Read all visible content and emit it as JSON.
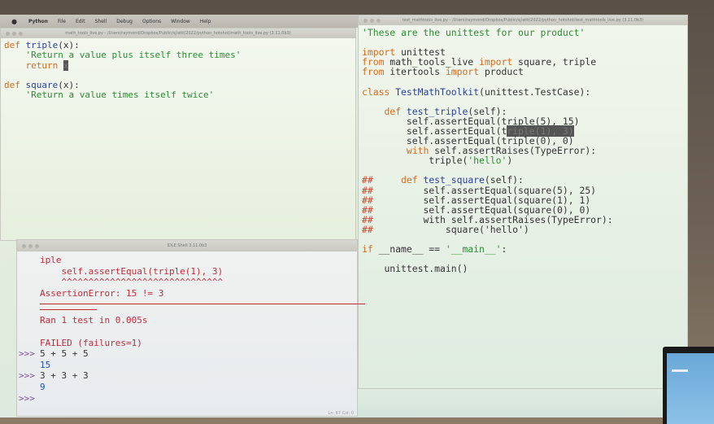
{
  "menubar": {
    "items": [
      "Python",
      "File",
      "Edit",
      "Shell",
      "Debug",
      "Options",
      "Window",
      "Help"
    ]
  },
  "left_editor": {
    "title": "math_tools_live.py - /Users/raymond/Dropbox/Public/sj/attl/2022/python_hotshot/math_tools_live.py (3.11.0b3)",
    "lines": [
      {
        "kw": "def ",
        "fn": "triple",
        "rest": "(x):"
      },
      {
        "indent": "    ",
        "st": "'Return a value plus itself three times'"
      },
      {
        "indent": "    ",
        "kw": "return ",
        "hl": "x"
      },
      {
        "blank": ""
      },
      {
        "kw": "def ",
        "fn": "square",
        "rest": "(x):"
      },
      {
        "indent": "    ",
        "st": "'Return a value times itself twice'"
      }
    ]
  },
  "right_editor": {
    "title": "test_mathtools_live.py - /Users/raymond/Dropbox/Public/sj/attl/2022/python_hotshot/test_mathtools_live.py (3.11.0b3)",
    "lines": [
      {
        "st": "'These are the unittest for our product'"
      },
      {
        "blank": ""
      },
      {
        "kw": "import ",
        "rest": "unittest"
      },
      {
        "kw": "from ",
        "rest": "math_tools_live ",
        "kw2": "import ",
        "rest2": "square, triple"
      },
      {
        "kw": "from ",
        "rest": "itertools ",
        "kw2": "import ",
        "rest2": "product"
      },
      {
        "blank": ""
      },
      {
        "kw": "class ",
        "fn": "TestMathToolkit",
        "rest": "(unittest.TestCase):"
      },
      {
        "blank": ""
      },
      {
        "indent": "    ",
        "kw": "def ",
        "fn": "test_triple",
        "rest": "(self):"
      },
      {
        "indent": "        ",
        "rest": "self.assertEqual(triple(5), 15)"
      },
      {
        "indent": "        ",
        "rest": "self.assertEqual(t",
        "hl": "riple(1), 3)"
      },
      {
        "indent": "        ",
        "rest": "self.assertEqual(triple(0), 0)"
      },
      {
        "indent": "        ",
        "kw": "with ",
        "rest": "self.assertRaises(TypeError):"
      },
      {
        "indent": "            ",
        "rest": "triple(",
        "st": "'hello'",
        "rest2": ")"
      },
      {
        "blank": ""
      },
      {
        "cm": "##",
        "indent": "    ",
        "kw": "def ",
        "fn": "test_square",
        "rest": "(self):"
      },
      {
        "cm": "##",
        "indent": "        ",
        "rest": "self.assertEqual(square(5), 25)"
      },
      {
        "cm": "##",
        "indent": "        ",
        "rest": "self.assertEqual(square(1), 1)"
      },
      {
        "cm": "##",
        "indent": "        ",
        "rest": "self.assertEqual(square(0), 0)"
      },
      {
        "cm": "##",
        "indent": "        ",
        "rest": "with self.assertRaises(TypeError):"
      },
      {
        "cm": "##",
        "indent": "            ",
        "rest": "square('hello')"
      },
      {
        "blank": ""
      },
      {
        "kw": "if ",
        "rest": "__name__ == ",
        "st": "'__main__'",
        "rest2": ":"
      },
      {
        "blank": ""
      },
      {
        "indent": "    ",
        "rest": "unittest.main()"
      }
    ]
  },
  "shell": {
    "title": "IDLE Shell 3.11.0b3",
    "status": "Ln: 67  Col: 0",
    "lines": [
      {
        "cls": "err",
        "text": "iple"
      },
      {
        "cls": "err",
        "text": "    self.assertEqual(triple(1), 3)"
      },
      {
        "cls": "err",
        "text": "    ^^^^^^^^^^^^^^^^^^^^^^^^^^^^^^"
      },
      {
        "cls": "err",
        "text": "AssertionError: 15 != 3"
      },
      {
        "cls": "sep"
      },
      {
        "cls": "sep short"
      },
      {
        "cls": "err",
        "text": "Ran 1 test in 0.005s"
      },
      {
        "cls": "err",
        "text": ""
      },
      {
        "cls": "err",
        "text": "FAILED (failures=1)"
      },
      {
        "cls": "in",
        "prompt": ">>>",
        "text": "5 + 5 + 5"
      },
      {
        "cls": "out",
        "text": "15"
      },
      {
        "cls": "in",
        "prompt": ">>>",
        "text": "3 + 3 + 3"
      },
      {
        "cls": "out",
        "text": "9"
      },
      {
        "cls": "in",
        "prompt": ">>>",
        "text": ""
      }
    ]
  },
  "colors": {
    "keyword": "#d06d22",
    "function_name": "#2b3f9a",
    "string": "#2c8a35",
    "error": "#c22a3a",
    "output": "#1f4fb5"
  }
}
